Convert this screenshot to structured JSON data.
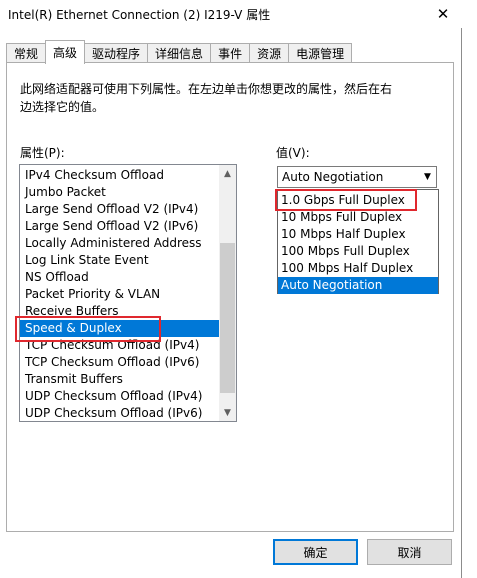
{
  "window": {
    "title": "Intel(R) Ethernet Connection (2) I219-V 属性",
    "close_glyph": "✕"
  },
  "tabs": [
    {
      "label": "常规",
      "active": false
    },
    {
      "label": "高级",
      "active": true
    },
    {
      "label": "驱动程序",
      "active": false
    },
    {
      "label": "详细信息",
      "active": false
    },
    {
      "label": "事件",
      "active": false
    },
    {
      "label": "资源",
      "active": false
    },
    {
      "label": "电源管理",
      "active": false
    }
  ],
  "description": "此网络适配器可使用下列属性。在左边单击你想更改的属性，然后在右边选择它的值。",
  "property_label": "属性(P):",
  "value_label": "值(V):",
  "properties": [
    "IPv4 Checksum Offload",
    "Jumbo Packet",
    "Large Send Offload V2 (IPv4)",
    "Large Send Offload V2 (IPv6)",
    "Locally Administered Address",
    "Log Link State Event",
    "NS Offload",
    "Packet Priority & VLAN",
    "Receive Buffers",
    "Speed & Duplex",
    "TCP Checksum Offload (IPv4)",
    "TCP Checksum Offload (IPv6)",
    "Transmit Buffers",
    "UDP Checksum Offload (IPv4)",
    "UDP Checksum Offload (IPv6)"
  ],
  "selected_property": "Speed & Duplex",
  "combo_value": "Auto Negotiation",
  "value_options": [
    "1.0 Gbps Full Duplex",
    "10 Mbps Full Duplex",
    "10 Mbps Half Duplex",
    "100 Mbps Full Duplex",
    "100 Mbps Half Duplex",
    "Auto Negotiation"
  ],
  "selected_option": "Auto Negotiation",
  "buttons": {
    "ok": "确定",
    "cancel": "取消"
  },
  "colors": {
    "selection": "#0078d7",
    "highlight_box": "#e0282e"
  },
  "icons": {
    "scroll_up": "▲",
    "scroll_down": "▼",
    "combo_arrow": "▼"
  }
}
